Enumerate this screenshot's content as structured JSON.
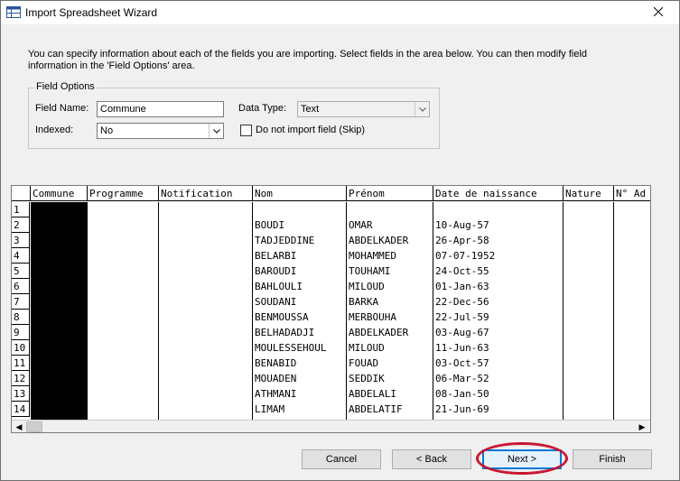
{
  "window": {
    "title": "Import Spreadsheet Wizard",
    "icon": "table-window-icon",
    "close_icon": "close-icon"
  },
  "intro": {
    "line1": "You can specify information about each of the fields you are importing. Select fields in the area below. You can then modify field",
    "line2": "information in the 'Field Options' area."
  },
  "field_options": {
    "legend": "Field Options",
    "field_name_label": "Field Name:",
    "field_name_value": "Commune",
    "data_type_label": "Data Type:",
    "data_type_value": "Text",
    "indexed_label": "Indexed:",
    "indexed_value": "No",
    "skip_label": "Do not import field (Skip)",
    "skip_checked": false
  },
  "grid": {
    "columns": [
      "Commune",
      "Programme",
      "Notification",
      "Nom",
      "Prénom",
      "Date de naissance",
      "Nature",
      "N° Ad"
    ],
    "row_numbers": [
      "1",
      "2",
      "3",
      "4",
      "5",
      "6",
      "7",
      "8",
      "9",
      "10",
      "11",
      "12",
      "13",
      "14"
    ],
    "rows": [
      {
        "nom": "",
        "prenom": "",
        "date": ""
      },
      {
        "nom": "BOUDI",
        "prenom": "OMAR",
        "date": "10-Aug-57"
      },
      {
        "nom": "TADJEDDINE",
        "prenom": "ABDELKADER",
        "date": "26-Apr-58"
      },
      {
        "nom": "BELARBI",
        "prenom": "MOHAMMED",
        "date": "07-07-1952"
      },
      {
        "nom": "BAROUDI",
        "prenom": "TOUHAMI",
        "date": "24-Oct-55"
      },
      {
        "nom": "BAHLOULI",
        "prenom": "MILOUD",
        "date": "01-Jan-63"
      },
      {
        "nom": "SOUDANI",
        "prenom": "BARKA",
        "date": "22-Dec-56"
      },
      {
        "nom": "BENMOUSSA",
        "prenom": "MERBOUHA",
        "date": "22-Jul-59"
      },
      {
        "nom": "BELHADADJI",
        "prenom": "ABDELKADER",
        "date": "03-Aug-67"
      },
      {
        "nom": "MOULESSEHOUL",
        "prenom": "MILOUD",
        "date": "11-Jun-63"
      },
      {
        "nom": "BENABID",
        "prenom": "FOUAD",
        "date": "03-Oct-57"
      },
      {
        "nom": "MOUADEN",
        "prenom": "SEDDIK",
        "date": "06-Mar-52"
      },
      {
        "nom": "ATHMANI",
        "prenom": "ABDELALI",
        "date": "08-Jan-50"
      },
      {
        "nom": "LIMAM",
        "prenom": "ABDELATIF",
        "date": "21-Jun-69"
      }
    ]
  },
  "buttons": {
    "cancel": "Cancel",
    "back": "< Back",
    "next": "Next >",
    "finish": "Finish"
  },
  "colors": {
    "highlight": "#c8102e",
    "default_button_border": "#0078d7"
  }
}
